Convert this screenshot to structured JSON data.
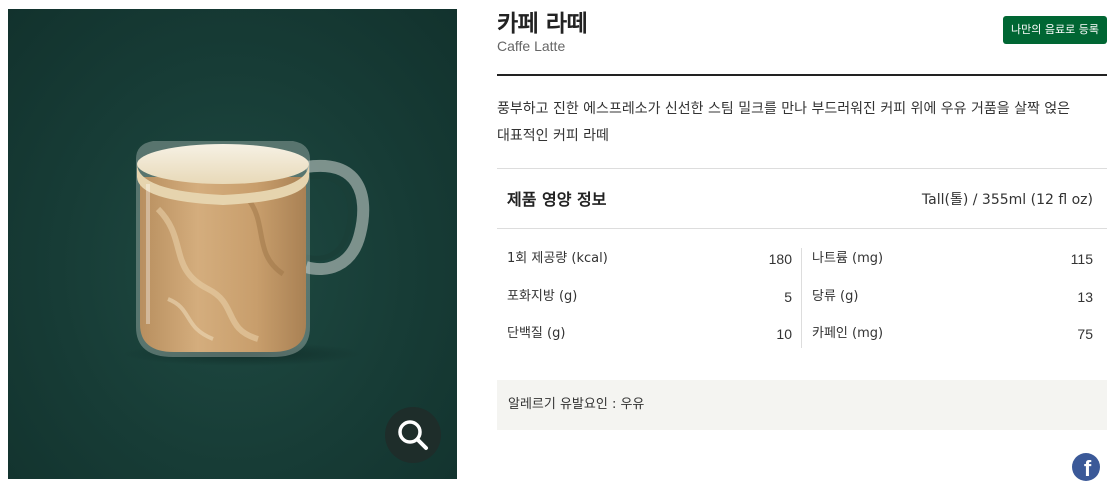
{
  "product": {
    "name_ko": "카페 라떼",
    "name_en": "Caffe Latte",
    "register_button": "나만의 음료로 등록",
    "description": "풍부하고 진한 에스프레소가 신선한 스팀 밀크를 만나 부드러워진 커피 위에 우유 거품을 살짝 얹은 대표적인 커피 라떼",
    "image_alt": "caffe-latte-in-glass-mug",
    "zoom_icon": "search-icon"
  },
  "nutrition": {
    "title": "제품 영양 정보",
    "serving": "Tall(톨) / 355ml (12 fl oz)",
    "left": [
      {
        "label": "1회 제공량 (kcal)",
        "value": "180"
      },
      {
        "label": "포화지방 (g)",
        "value": "5"
      },
      {
        "label": "단백질 (g)",
        "value": "10"
      }
    ],
    "right": [
      {
        "label": "나트륨 (mg)",
        "value": "115"
      },
      {
        "label": "당류 (g)",
        "value": "13"
      },
      {
        "label": "카페인 (mg)",
        "value": "75"
      }
    ]
  },
  "allergy": {
    "text": "알레르기 유발요인 : 우유"
  },
  "share": {
    "facebook_label": "f",
    "facebook_icon": "facebook-icon"
  },
  "colors": {
    "brand_green": "#006633",
    "image_bg": "#173c36",
    "facebook_blue": "#3b5998"
  }
}
